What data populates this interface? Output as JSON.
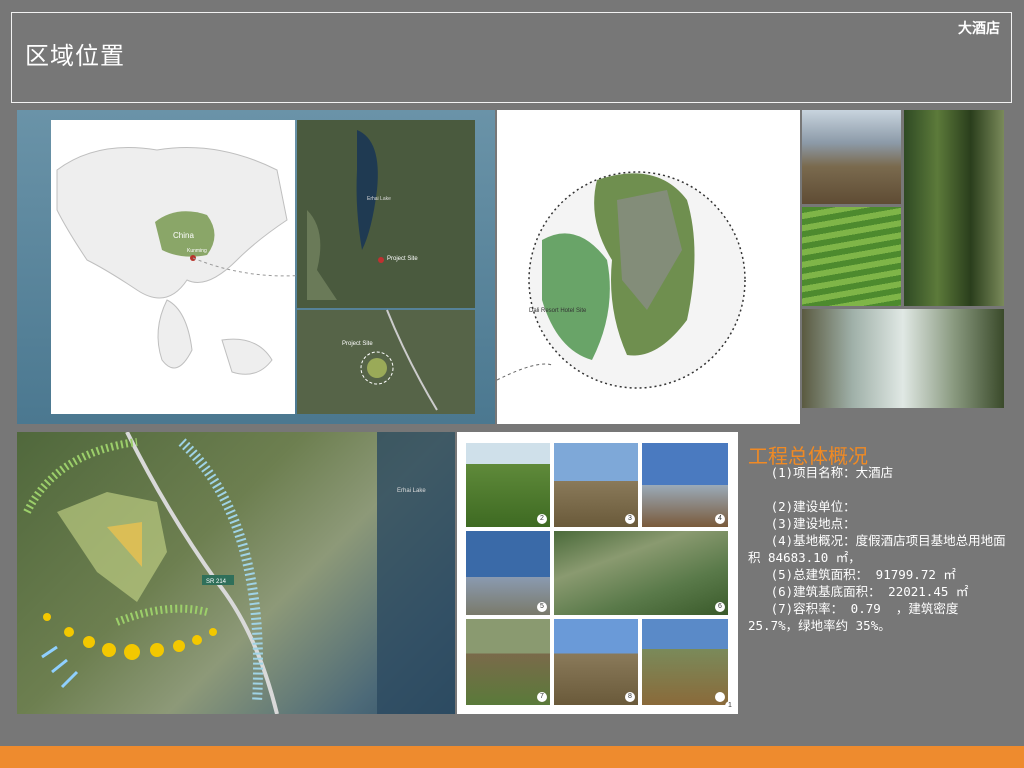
{
  "header": {
    "title": "区域位置",
    "hotel_tag": "大酒店"
  },
  "map_labels": {
    "china": "China",
    "kunming": "Kunming",
    "project_site": "Project Site",
    "project_site_lower": "Project Site",
    "erhai_lake": "Erhai Lake",
    "dali_resort": "Dali Resort Hotel Site",
    "highway": "SR 214"
  },
  "overview": {
    "title": "工程总体概况",
    "lines": [
      "   (1)项目名称：大酒店",
      "",
      "   (2)建设单位：",
      "   (3)建设地点：",
      "   (4)基地概况：度假酒店项目基地总用地面积 84683.10 ㎡，",
      "   (5)总建筑面积： 91799.72 ㎡",
      "   (6)建筑基底面积： 22021.45 ㎡",
      "   (7)容积率： 0.79  ，建筑密度 25.7%，绿地率约 35%。"
    ]
  },
  "photo_numbers": [
    "1",
    "2",
    "3",
    "4",
    "5",
    "6",
    "7",
    "8"
  ]
}
